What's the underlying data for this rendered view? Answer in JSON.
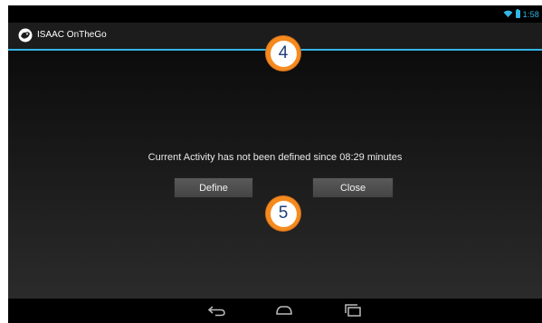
{
  "status_bar": {
    "time": "1:58",
    "icons": [
      "wifi-icon",
      "battery-icon"
    ],
    "accent_color": "#33b5e5"
  },
  "action_bar": {
    "logo_icon": "isaac-logo-icon",
    "title": "ISAAC OnTheGo"
  },
  "dialog": {
    "message_prefix": "Current Activity has not been defined since",
    "elapsed_time": "08:29",
    "message_suffix": "minutes",
    "define_label": "Define",
    "close_label": "Close"
  },
  "nav_bar": {
    "icons": [
      "back-icon",
      "home-icon",
      "recents-icon"
    ]
  },
  "annotations": {
    "badge_top": "4",
    "badge_bottom": "5",
    "badge_color": "#f58a1f"
  }
}
